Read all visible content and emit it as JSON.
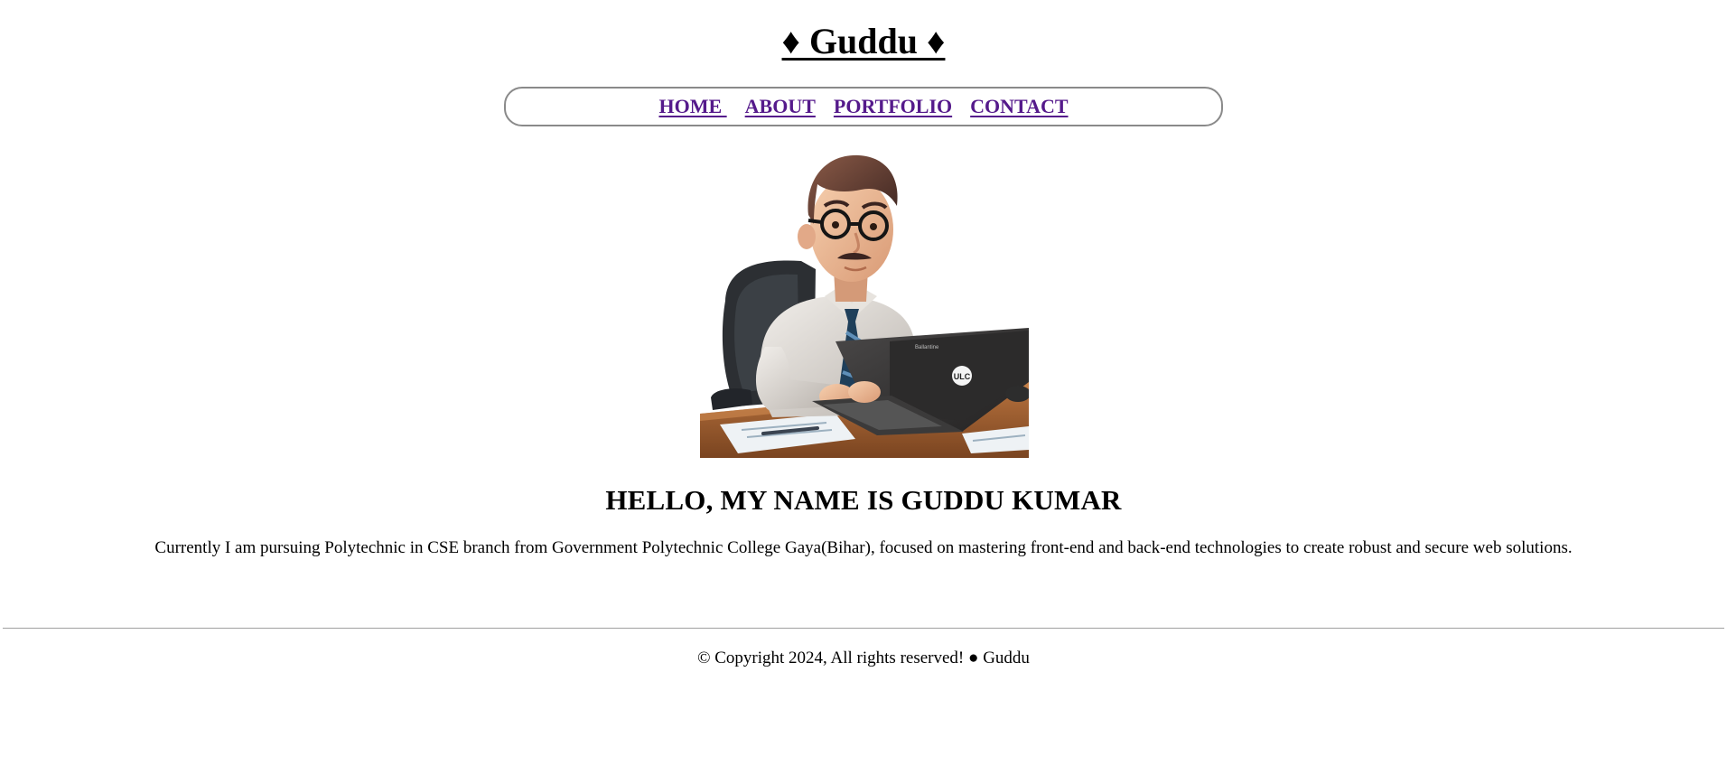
{
  "header": {
    "title": "♦ Guddu ♦"
  },
  "nav": {
    "items": [
      {
        "label": "HOME "
      },
      {
        "label": "ABOUT"
      },
      {
        "label": "PORTFOLIO"
      },
      {
        "label": "CONTACT"
      }
    ]
  },
  "hero": {
    "image": "cartoon-developer-at-laptop",
    "laptop_logo": "ULC",
    "laptop_brand": "Ballantine"
  },
  "main": {
    "headline": "HELLO, MY NAME IS GUDDU KUMAR",
    "intro": "Currently I am pursuing Polytechnic in CSE branch from Government Polytechnic College Gaya(Bihar), focused on mastering front-end and back-end technologies to create robust and secure web solutions."
  },
  "footer": {
    "text": "© Copyright 2024, All rights reserved! ● Guddu"
  },
  "colors": {
    "nav_link": "#551a8b",
    "nav_border": "#8a8a8a",
    "divider": "#a0a0a0"
  }
}
